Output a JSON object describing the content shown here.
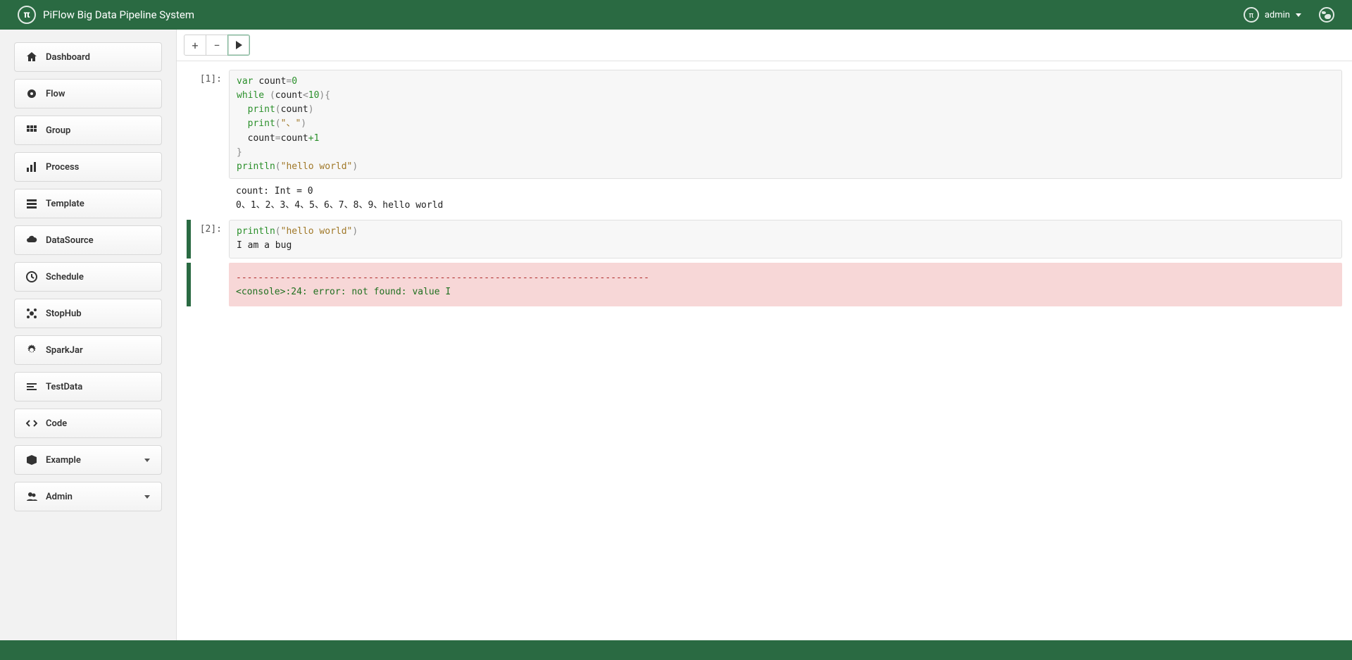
{
  "header": {
    "title": "PiFlow Big Data Pipeline System",
    "user": "admin"
  },
  "sidebar": {
    "items": [
      {
        "label": "Dashboard",
        "icon": "home"
      },
      {
        "label": "Flow",
        "icon": "dot"
      },
      {
        "label": "Group",
        "icon": "grid"
      },
      {
        "label": "Process",
        "icon": "chart"
      },
      {
        "label": "Template",
        "icon": "list"
      },
      {
        "label": "DataSource",
        "icon": "cloud"
      },
      {
        "label": "Schedule",
        "icon": "clock"
      },
      {
        "label": "StopHub",
        "icon": "cog"
      },
      {
        "label": "SparkJar",
        "icon": "gear"
      },
      {
        "label": "TestData",
        "icon": "lines"
      },
      {
        "label": "Code",
        "icon": "code"
      },
      {
        "label": "Example",
        "icon": "box",
        "expandable": true
      },
      {
        "label": "Admin",
        "icon": "users",
        "expandable": true
      }
    ]
  },
  "toolbar": {
    "add": "+",
    "remove": "−"
  },
  "cells": [
    {
      "prompt": "[1]:",
      "output_lines": [
        "count: Int = 0",
        "0、1、2、3、4、5、6、7、8、9、hello world"
      ]
    },
    {
      "prompt": "[2]:",
      "error_dashes": "---------------------------------------------------------------------------",
      "error_text": "<console>:24: error: not found: value I"
    }
  ],
  "code1": {
    "kw_var": "var",
    "id_count": "count",
    "eq": "=",
    "zero": "0",
    "kw_while": "while",
    "lp": " (",
    "lt": "<",
    "ten": "10",
    "rp_brace": "){",
    "fn_print": "print",
    "lp2": "(",
    "rp2": ")",
    "str_sep": "\"、\"",
    "plus": "+",
    "one": "1",
    "rbrace": "}",
    "fn_println": "println",
    "str_hw": "\"hello world\""
  },
  "code2": {
    "fn_println": "println",
    "lp": "(",
    "str_hw": "\"hello world\"",
    "rp": ")",
    "line2": "I am a bug"
  }
}
